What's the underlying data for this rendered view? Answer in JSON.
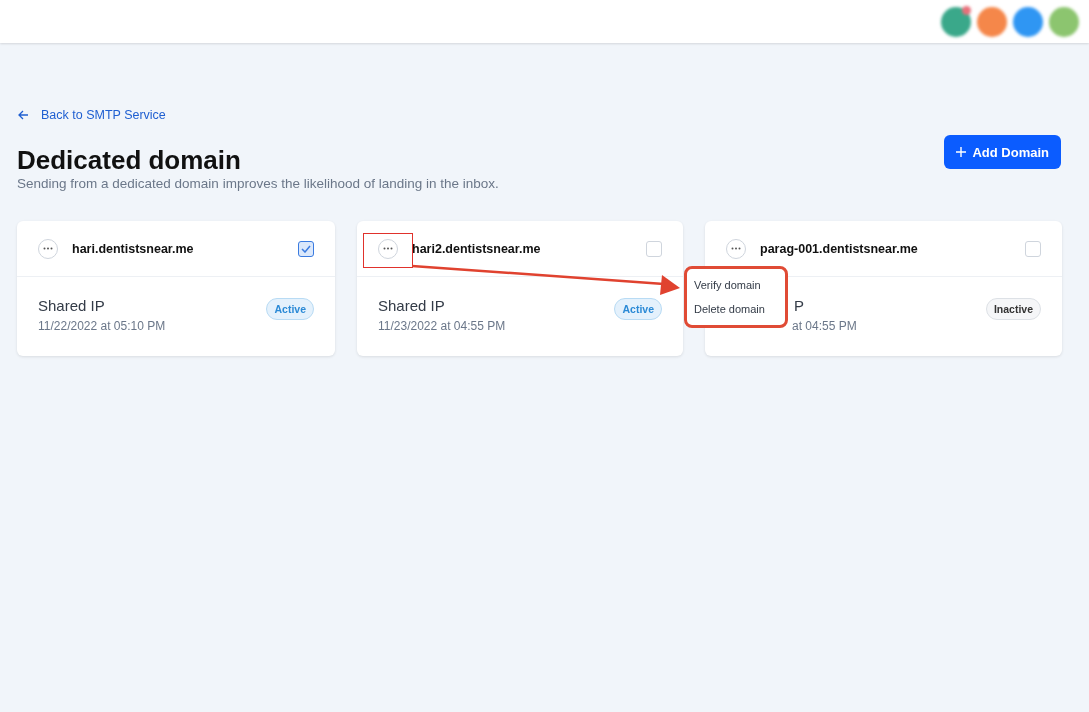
{
  "header": {
    "avatars": [
      {
        "color": "#3aa88a",
        "badge": true
      },
      {
        "color": "#f5874a",
        "badge": false
      },
      {
        "color": "#2f96f3",
        "badge": false
      },
      {
        "color": "#8cc56f",
        "badge": false
      }
    ]
  },
  "back_link": "Back to SMTP Service",
  "title": "Dedicated domain",
  "subtitle": "Sending from a dedicated domain improves the likelihood of landing in the inbox.",
  "add_button": "Add Domain",
  "cards": [
    {
      "domain": "hari.dentistsnear.me",
      "checked": true,
      "highlighted": false,
      "partly_covered": false,
      "ip_label": "Shared IP",
      "date": "11/22/2022 at 05:10 PM",
      "status": "Active",
      "active": true
    },
    {
      "domain": "hari2.dentistsnear.me",
      "checked": false,
      "highlighted": true,
      "partly_covered": false,
      "ip_label": "Shared IP",
      "date": "11/23/2022 at 04:55 PM",
      "status": "Active",
      "active": true
    },
    {
      "domain": "parag-001.dentistsnear.me",
      "checked": false,
      "highlighted": false,
      "partly_covered": true,
      "ip_label": "P",
      "date": "at 04:55 PM",
      "status": "Inactive",
      "active": false
    }
  ],
  "menu": {
    "highlighted": true,
    "items": [
      "Verify domain",
      "Delete domain"
    ]
  }
}
